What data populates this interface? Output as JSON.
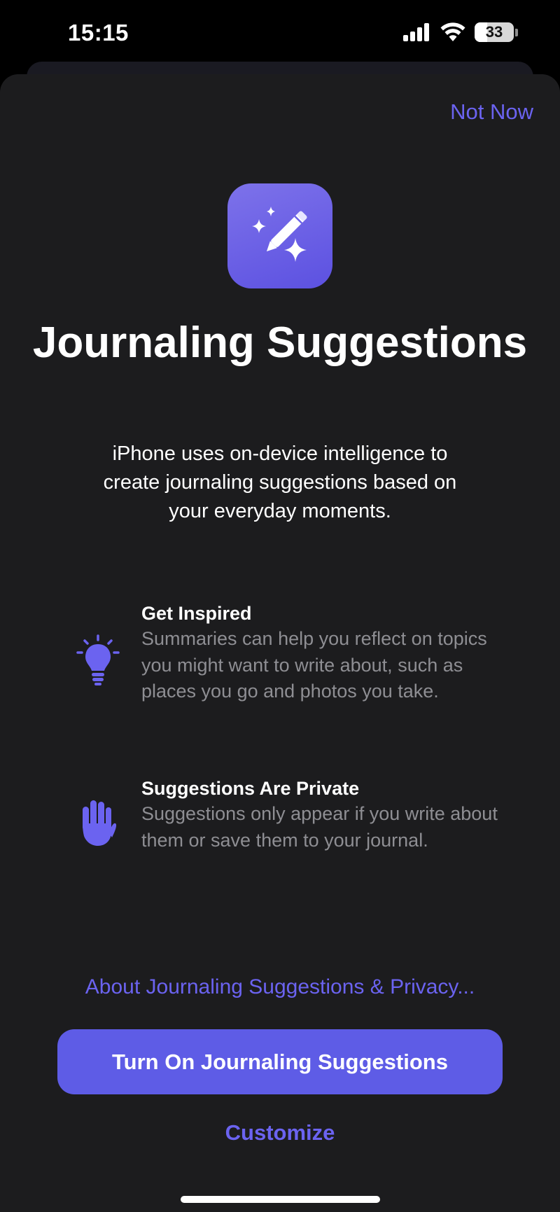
{
  "status_bar": {
    "time": "15:15",
    "battery": "33",
    "battery_level": 0.33
  },
  "header": {
    "not_now_label": "Not Now"
  },
  "app_icon": {
    "name": "pencil-sparkles-icon",
    "color": "#6b62e8"
  },
  "main": {
    "title": "Journaling Suggestions",
    "subtitle": "iPhone uses on-device intelligence to create journaling suggestions based on your everyday moments."
  },
  "features": [
    {
      "icon": "lightbulb-icon",
      "title": "Get Inspired",
      "description": "Summaries can help you reflect on topics you might want to write about, such as places you go and photos you take."
    },
    {
      "icon": "raised-hand-icon",
      "title": "Suggestions Are Private",
      "description": "Suggestions only appear if you write about them or save them to your journal."
    }
  ],
  "footer": {
    "privacy_link": "About Journaling Suggestions & Privacy...",
    "primary_button": "Turn On Journaling Suggestions",
    "customize": "Customize"
  },
  "colors": {
    "accent": "#5e5ce6",
    "link": "#6b63f0",
    "sheet_background": "#1c1c1e",
    "secondary_text": "#8e8e93"
  }
}
